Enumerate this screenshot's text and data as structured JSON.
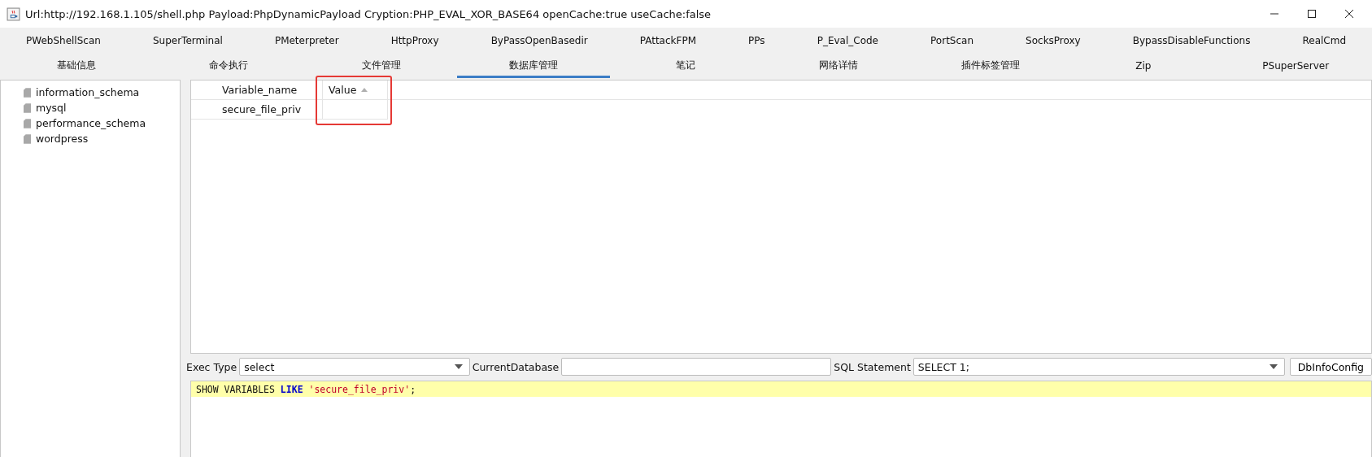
{
  "window": {
    "title": "Url:http://192.168.1.105/shell.php Payload:PhpDynamicPayload Cryption:PHP_EVAL_XOR_BASE64 openCache:true useCache:false"
  },
  "plugin_tabs": [
    {
      "label": "PWebShellScan",
      "selected": false
    },
    {
      "label": "SuperTerminal",
      "selected": false
    },
    {
      "label": "PMeterpreter",
      "selected": false
    },
    {
      "label": "HttpProxy",
      "selected": false
    },
    {
      "label": "ByPassOpenBasedir",
      "selected": false
    },
    {
      "label": "PAttackFPM",
      "selected": false
    },
    {
      "label": "PPs",
      "selected": false
    },
    {
      "label": "P_Eval_Code",
      "selected": false
    },
    {
      "label": "PortScan",
      "selected": false
    },
    {
      "label": "SocksProxy",
      "selected": false
    },
    {
      "label": "BypassDisableFunctions",
      "selected": false
    },
    {
      "label": "RealCmd",
      "selected": false
    }
  ],
  "main_tabs": [
    {
      "label": "基础信息",
      "selected": false
    },
    {
      "label": "命令执行",
      "selected": false
    },
    {
      "label": "文件管理",
      "selected": false
    },
    {
      "label": "数据库管理",
      "selected": true
    },
    {
      "label": "笔记",
      "selected": false
    },
    {
      "label": "网络详情",
      "selected": false
    },
    {
      "label": "插件标签管理",
      "selected": false
    },
    {
      "label": "Zip",
      "selected": false
    },
    {
      "label": "PSuperServer",
      "selected": false
    }
  ],
  "databases": [
    "information_schema",
    "mysql",
    "performance_schema",
    "wordpress"
  ],
  "table": {
    "columns": [
      {
        "label": "Variable_name",
        "sorted": false
      },
      {
        "label": "Value",
        "sorted": true
      }
    ],
    "rows": [
      [
        "secure_file_priv"
      ]
    ]
  },
  "controls": {
    "exec_type_label": "Exec Type",
    "exec_type": "select",
    "current_database_label": "CurrentDatabase",
    "sql_statement_label": "SQL Statement",
    "sql_statement": "SELECT 1;",
    "config_button": "DbInfoConfig"
  },
  "editor": {
    "tokens": [
      {
        "kind": "plain",
        "text": "SHOW VARIABLES "
      },
      {
        "kind": "keyword",
        "text": "LIKE"
      },
      {
        "kind": "string",
        "text": " 'secure_file_priv'"
      },
      {
        "kind": "plain",
        "text": ";"
      }
    ]
  }
}
